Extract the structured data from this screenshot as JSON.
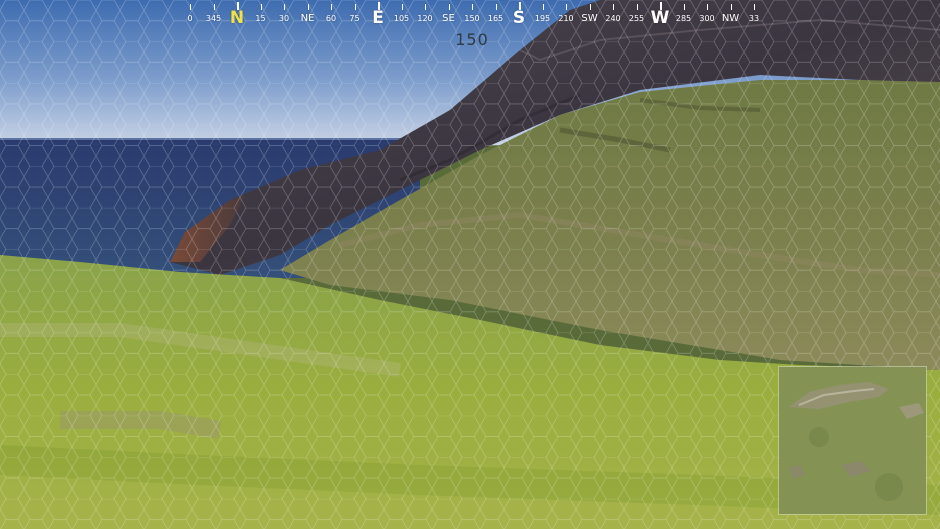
{
  "hud": {
    "compass": {
      "labels": [
        {
          "text": "0",
          "type": "degree"
        },
        {
          "text": "345",
          "type": "degree"
        },
        {
          "text": "N",
          "type": "cardinal",
          "active": true
        },
        {
          "text": "15",
          "type": "degree"
        },
        {
          "text": "30",
          "type": "degree"
        },
        {
          "text": "NE",
          "type": "intercardinal"
        },
        {
          "text": "60",
          "type": "degree"
        },
        {
          "text": "75",
          "type": "degree"
        },
        {
          "text": "E",
          "type": "cardinal"
        },
        {
          "text": "105",
          "type": "degree"
        },
        {
          "text": "120",
          "type": "degree"
        },
        {
          "text": "SE",
          "type": "intercardinal"
        },
        {
          "text": "150",
          "type": "degree"
        },
        {
          "text": "165",
          "type": "degree"
        },
        {
          "text": "S",
          "type": "cardinal"
        },
        {
          "text": "195",
          "type": "degree"
        },
        {
          "text": "210",
          "type": "degree"
        },
        {
          "text": "SW",
          "type": "intercardinal"
        },
        {
          "text": "240",
          "type": "degree"
        },
        {
          "text": "255",
          "type": "degree"
        },
        {
          "text": "W",
          "type": "cardinal"
        },
        {
          "text": "285",
          "type": "degree"
        },
        {
          "text": "300",
          "type": "degree"
        },
        {
          "text": "NW",
          "type": "intercardinal"
        },
        {
          "text": "33",
          "type": "degree"
        }
      ],
      "active_color": "#f0e14a",
      "label_color": "#ffffff"
    },
    "heading_value": "150",
    "minimap": {
      "terrain_color": "#7b8a4a",
      "icon": "minimap-terrain"
    }
  },
  "scene": {
    "elements": [
      "sky",
      "ocean",
      "rocky-mountain",
      "grassy-hill",
      "grass-foreground"
    ],
    "overlay": "hexagon-shield-grid"
  }
}
